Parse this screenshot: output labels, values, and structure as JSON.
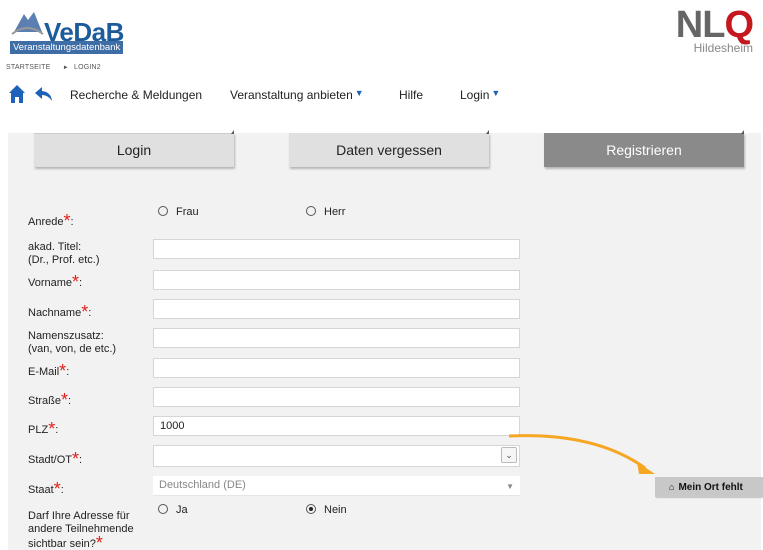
{
  "header": {
    "logo_text": "VeDaB",
    "logo_sub": "Veranstaltungsdatenbank",
    "nlq_main": "NL",
    "nlq_q": "Q",
    "nlq_sub": "Hildesheim"
  },
  "breadcrumb": [
    "STARTSEITE",
    "LOGIN2"
  ],
  "nav": {
    "items": [
      {
        "label": "Recherche & Meldungen",
        "has_caret": false
      },
      {
        "label": "Veranstaltung anbieten",
        "has_caret": true
      },
      {
        "label": "Hilfe",
        "has_caret": false
      },
      {
        "label": "Login",
        "has_caret": true
      }
    ],
    "caret": "▼"
  },
  "tabs": [
    {
      "label": "Login",
      "active": false
    },
    {
      "label": "Daten vergessen",
      "active": false
    },
    {
      "label": "Registrieren",
      "active": true
    }
  ],
  "form": {
    "anrede": {
      "label": "Anrede",
      "options": [
        "Frau",
        "Herr"
      ],
      "selected": null
    },
    "titel": {
      "label_line1": "akad. Titel:",
      "label_line2": "(Dr., Prof. etc.)",
      "value": ""
    },
    "vorname": {
      "label": "Vorname",
      "value": ""
    },
    "nachname": {
      "label": "Nachname",
      "value": ""
    },
    "namenszusatz": {
      "label_line1": "Namenszusatz:",
      "label_line2": "(van, von, de etc.)",
      "value": ""
    },
    "email": {
      "label": "E-Mail",
      "value": ""
    },
    "strasse": {
      "label": "Straße",
      "value": ""
    },
    "plz": {
      "label": "PLZ",
      "value": "1000"
    },
    "stadt": {
      "label": "Stadt/OT",
      "value": ""
    },
    "staat": {
      "label": "Staat",
      "value": "Deutschland (DE)"
    },
    "adresse_sichtbar": {
      "label_line1": "Darf Ihre Adresse für",
      "label_line2": "andere Teilnehmende",
      "label_line3": "sichtbar sein?",
      "options": [
        "Ja",
        "Nein"
      ],
      "selected": "Nein"
    },
    "required_marker": "*",
    "colon": ":"
  },
  "mein_ort_button": {
    "label": "Mein Ort fehlt",
    "icon": "home-icon"
  },
  "colors": {
    "brand_blue": "#1d5c9b",
    "nlq_red": "#c4171e",
    "required_red": "#e0201a",
    "active_tab": "#8a8a8a",
    "inactive_tab": "#e0e0e0",
    "arrow_orange": "#f5a623"
  }
}
